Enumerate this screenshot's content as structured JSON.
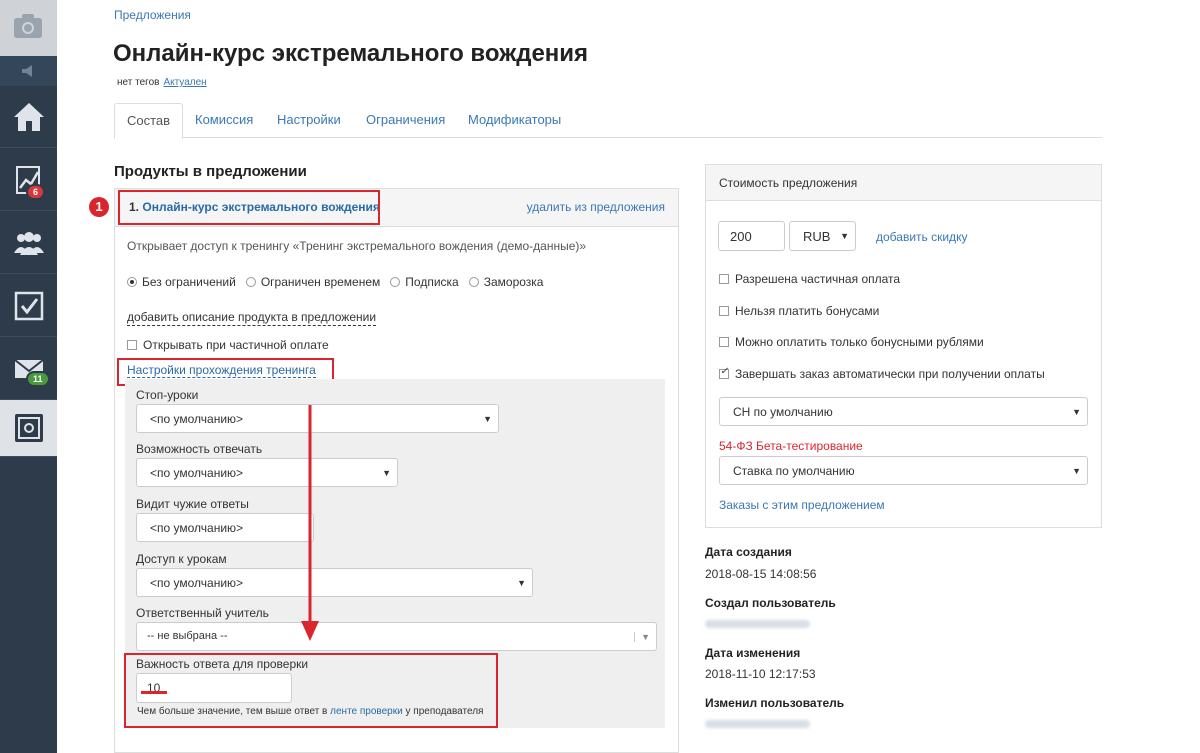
{
  "sidebar": {
    "items": [
      {
        "icon": "camera-icon"
      },
      {
        "icon": "speaker-icon"
      },
      {
        "icon": "home-icon"
      },
      {
        "icon": "chart-icon",
        "badge": "6"
      },
      {
        "icon": "users-icon"
      },
      {
        "icon": "checkbox-icon"
      },
      {
        "icon": "mail-icon",
        "badge": "11"
      },
      {
        "icon": "safe-icon"
      }
    ]
  },
  "breadcrumb": "Предложения",
  "page_title": "Онлайн-курс экстремального вождения",
  "tags": {
    "no_tags": "нет тегов",
    "status": "Актуален"
  },
  "tabs": [
    "Состав",
    "Комиссия",
    "Настройки",
    "Ограничения",
    "Модификаторы"
  ],
  "products": {
    "heading": "Продукты в предложении",
    "marker": "1",
    "item_number": "1.",
    "item_name": "Онлайн-курс экстремального вождения",
    "delete_link": "удалить из предложения",
    "description": "Открывает доступ к тренингу «Тренинг экстремального вождения (демо-данные)»",
    "radios": [
      "Без ограничений",
      "Ограничен временем",
      "Подписка",
      "Заморозка"
    ],
    "add_description": "добавить описание продукта в предложении",
    "partial_open": "Открывать при частичной оплате",
    "training_settings_link": "Настройки прохождения тренинга",
    "fields": {
      "stop_lessons": {
        "label": "Стоп-уроки",
        "value": "<по умолчанию>"
      },
      "can_answer": {
        "label": "Возможность отвечать",
        "value": "<по умолчанию>"
      },
      "see_others": {
        "label": "Видит чужие ответы",
        "value": "<по умолчанию>"
      },
      "lesson_access": {
        "label": "Доступ к урокам",
        "value": "<по умолчанию>"
      },
      "teacher": {
        "label": "Ответственный учитель",
        "value": "-- не выбрана --"
      },
      "importance": {
        "label": "Важность ответа для проверки",
        "value": "10"
      }
    },
    "help_prefix": "Чем больше значение, тем выше ответ в ",
    "help_link": "ленте проверки",
    "help_suffix": " у преподавателя"
  },
  "cost": {
    "heading": "Стоимость предложения",
    "price": "200",
    "currency": "RUB",
    "add_discount": "добавить скидку",
    "checkboxes": [
      {
        "label": "Разрешена частичная оплата",
        "checked": false
      },
      {
        "label": "Нельзя платить бонусами",
        "checked": false
      },
      {
        "label": "Можно оплатить только бонусными рублями",
        "checked": false
      },
      {
        "label": "Завершать заказ автоматически при получении оплаты",
        "checked": true
      }
    ],
    "tax_select": "СН по умолчанию",
    "fz_label": "54-ФЗ Бета-тестирование",
    "rate_select": "Ставка по умолчанию",
    "orders_link": "Заказы с этим предложением"
  },
  "meta": {
    "created_label": "Дата создания",
    "created_value": "2018-08-15 14:08:56",
    "created_by_label": "Создал пользователь",
    "modified_label": "Дата изменения",
    "modified_value": "2018-11-10 12:17:53",
    "modified_by_label": "Изменил пользователь"
  },
  "colors": {
    "accent": "#3a78b4",
    "highlight": "#d9262e",
    "sidebar": "#2d3b4a"
  }
}
